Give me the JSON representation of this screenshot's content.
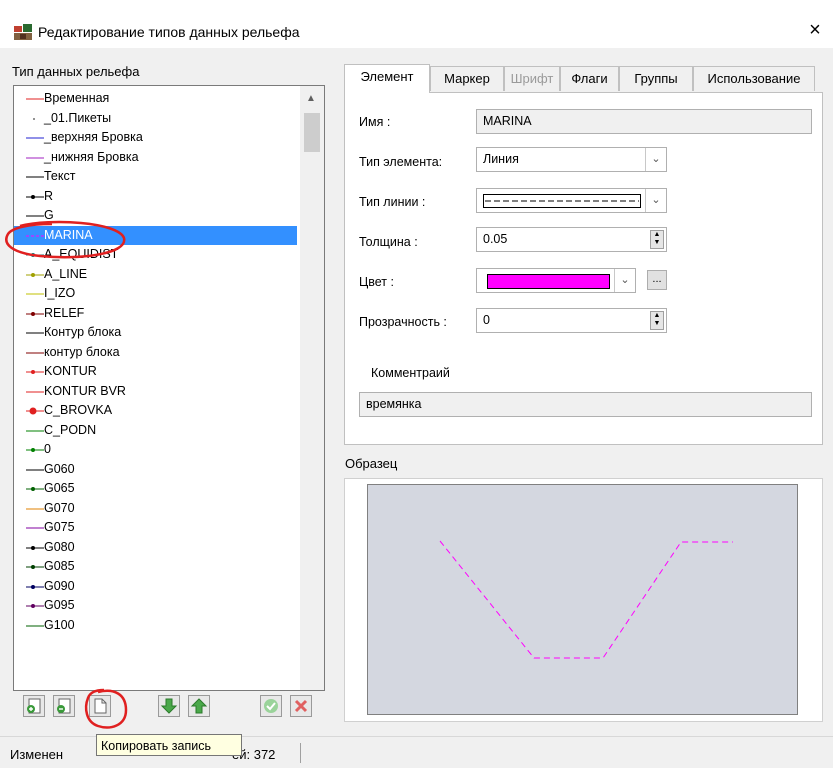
{
  "window": {
    "title": "Редактирование типов данных рельефа",
    "close_glyph": "×",
    "icon": "app-icon"
  },
  "left_panel": {
    "label": "Тип данных рельефа",
    "items": [
      {
        "label": "Временная",
        "color": "#e02020",
        "style": "solid"
      },
      {
        "label": "_01.Пикеты",
        "color": "#707070",
        "style": "dot"
      },
      {
        "label": "_верхняя Бровка",
        "color": "#2020d0",
        "style": "solid"
      },
      {
        "label": "_нижняя Бровка",
        "color": "#a020c0",
        "style": "solid"
      },
      {
        "label": "Текст",
        "color": "#000000",
        "style": "solid"
      },
      {
        "label": "R",
        "color": "#000000",
        "style": "marker"
      },
      {
        "label": "G",
        "color": "#000000",
        "style": "solid"
      },
      {
        "label": "MARINA",
        "color": "#ff00ff",
        "style": "dash",
        "selected": true
      },
      {
        "label": "A_EQUIDIST",
        "color": "#008080",
        "style": "marker"
      },
      {
        "label": "A_LINE",
        "color": "#a0a000",
        "style": "marker"
      },
      {
        "label": "I_IZO",
        "color": "#c0c000",
        "style": "solid"
      },
      {
        "label": "RELEF",
        "color": "#800000",
        "style": "marker"
      },
      {
        "label": "Контур блока",
        "color": "#000000",
        "style": "solid"
      },
      {
        "label": "контур блока",
        "color": "#800000",
        "style": "solid"
      },
      {
        "label": "KONTUR",
        "color": "#e02020",
        "style": "marker"
      },
      {
        "label": "KONTUR BVR",
        "color": "#e02020",
        "style": "solid"
      },
      {
        "label": "C_BROVKA",
        "color": "#e02020",
        "style": "bigmarker"
      },
      {
        "label": "C_PODN",
        "color": "#008000",
        "style": "solid"
      },
      {
        "label": "0",
        "color": "#008000",
        "style": "marker"
      },
      {
        "label": "G060",
        "color": "#000000",
        "style": "solid"
      },
      {
        "label": "G065",
        "color": "#006000",
        "style": "marker"
      },
      {
        "label": "G070",
        "color": "#e08000",
        "style": "solid"
      },
      {
        "label": "G075",
        "color": "#8000a0",
        "style": "solid"
      },
      {
        "label": "G080",
        "color": "#000000",
        "style": "marker"
      },
      {
        "label": "G085",
        "color": "#004000",
        "style": "marker"
      },
      {
        "label": "G090",
        "color": "#000060",
        "style": "marker"
      },
      {
        "label": "G095",
        "color": "#600060",
        "style": "marker"
      },
      {
        "label": "G100",
        "color": "#006000",
        "style": "solid"
      }
    ]
  },
  "toolbar": [
    {
      "name": "add-record-button",
      "icon": "add-doc-icon"
    },
    {
      "name": "remove-record-button",
      "icon": "remove-doc-icon"
    },
    {
      "name": "copy-record-button",
      "icon": "copy-doc-icon"
    },
    {
      "name": "move-down-button",
      "icon": "arrow-down-icon"
    },
    {
      "name": "move-up-button",
      "icon": "arrow-up-icon"
    },
    {
      "name": "ok-button",
      "icon": "check-icon"
    },
    {
      "name": "cancel-button",
      "icon": "cross-icon"
    }
  ],
  "status": {
    "text": "Изменен",
    "count_text": "ей: 372",
    "tooltip": "Копировать запись"
  },
  "tabs": [
    {
      "label": "Элемент",
      "active": true
    },
    {
      "label": "Маркер"
    },
    {
      "label": "Шрифт",
      "disabled": true
    },
    {
      "label": "Флаги"
    },
    {
      "label": "Группы"
    },
    {
      "label": "Использование"
    }
  ],
  "element_tab": {
    "name_label": "Имя :",
    "name_value": "MARINA",
    "type_label": "Тип элемента:",
    "type_value": "Линия",
    "linetype_label": "Тип линии :",
    "thickness_label": "Толщина :",
    "thickness_value": "0.05",
    "color_label": "Цвет :",
    "color_value": "#ff00ff",
    "color_more": "...",
    "transparency_label": "Прозрачность :",
    "transparency_value": "0",
    "comment_label": "Комментраий",
    "comment_value": "времянка"
  },
  "preview": {
    "label": "Образец",
    "line_color": "#ff00ff"
  },
  "colors": {
    "selection": "#3390ff",
    "annotation": "#e02020"
  }
}
